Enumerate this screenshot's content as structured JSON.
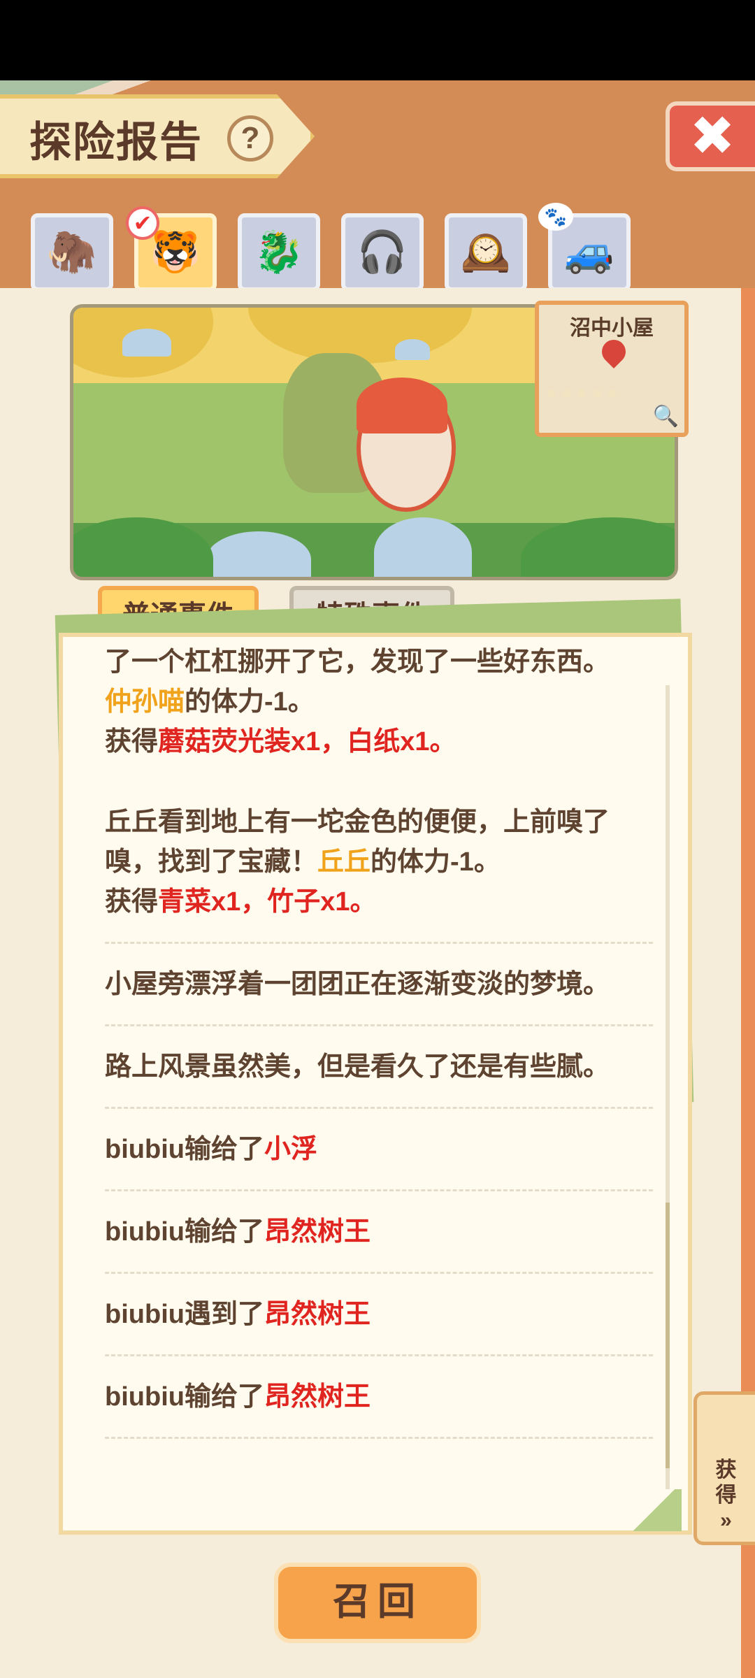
{
  "header": {
    "title": "探险报告",
    "help_icon": "?",
    "close_icon": "✖"
  },
  "avatars": [
    {
      "name": "mammoth-avatar",
      "icon": "🦣",
      "selected": false
    },
    {
      "name": "tiger-avatar",
      "icon": "🐯",
      "selected": true
    },
    {
      "name": "dragon-avatar",
      "icon": "🐉",
      "selected": false
    },
    {
      "name": "explorer-avatar",
      "icon": "🎧",
      "selected": false
    },
    {
      "name": "clock-avatar",
      "icon": "🕰️",
      "selected": false
    },
    {
      "name": "truck-avatar",
      "icon": "🚙",
      "selected": false
    }
  ],
  "check_icon": "✔",
  "paw_icon": "🐾",
  "scene": {
    "location": "沼中小屋",
    "zoom_icon": "🔍"
  },
  "tabs": {
    "normal": "普通事件",
    "special": "特殊事件"
  },
  "log": {
    "e1_line1": "了一个杠杠挪开了它，发现了一些好东西。",
    "e1_actor": "仲孙喵",
    "e1_stamina": "的体力-1。",
    "e1_get_prefix": "获得",
    "e1_items": "蘑菇荧光装x1，白纸x1。",
    "e2_line1": "丘丘看到地上有一坨金色的便便，上前嗅了",
    "e2_line2a": "嗅，找到了宝藏！",
    "e2_actor": "丘丘",
    "e2_stamina": "的体力-1。",
    "e2_get_prefix": "获得",
    "e2_items": "青菜x1，竹子x1。",
    "e3": "小屋旁漂浮着一团团正在逐渐变淡的梦境。",
    "e4": "路上风景虽然美，但是看久了还是有些腻。",
    "e5_text": "biubiu输给了",
    "e5_target": "小浮",
    "e6_text": "biubiu输给了",
    "e6_target": "昂然树王",
    "e7_text": "biubiu遇到了",
    "e7_target": "昂然树王",
    "e8_text": "biubiu输给了",
    "e8_target": "昂然树王"
  },
  "obtain_tag": {
    "line1": "获",
    "line2": "得",
    "arrow": "»"
  },
  "recall_button": "召回"
}
